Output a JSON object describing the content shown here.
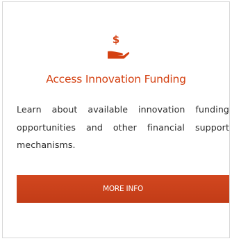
{
  "card": {
    "icon": "hand-holding-dollar-icon",
    "title": "Access Innovation Funding",
    "description": "Learn about available innovation funding opportunities and other financial support mechanisms.",
    "button_label": "MORE INFO"
  },
  "colors": {
    "accent": "#d44112",
    "button": "#c9401a",
    "border": "#d8d8d8",
    "text": "#2b2b2b"
  }
}
